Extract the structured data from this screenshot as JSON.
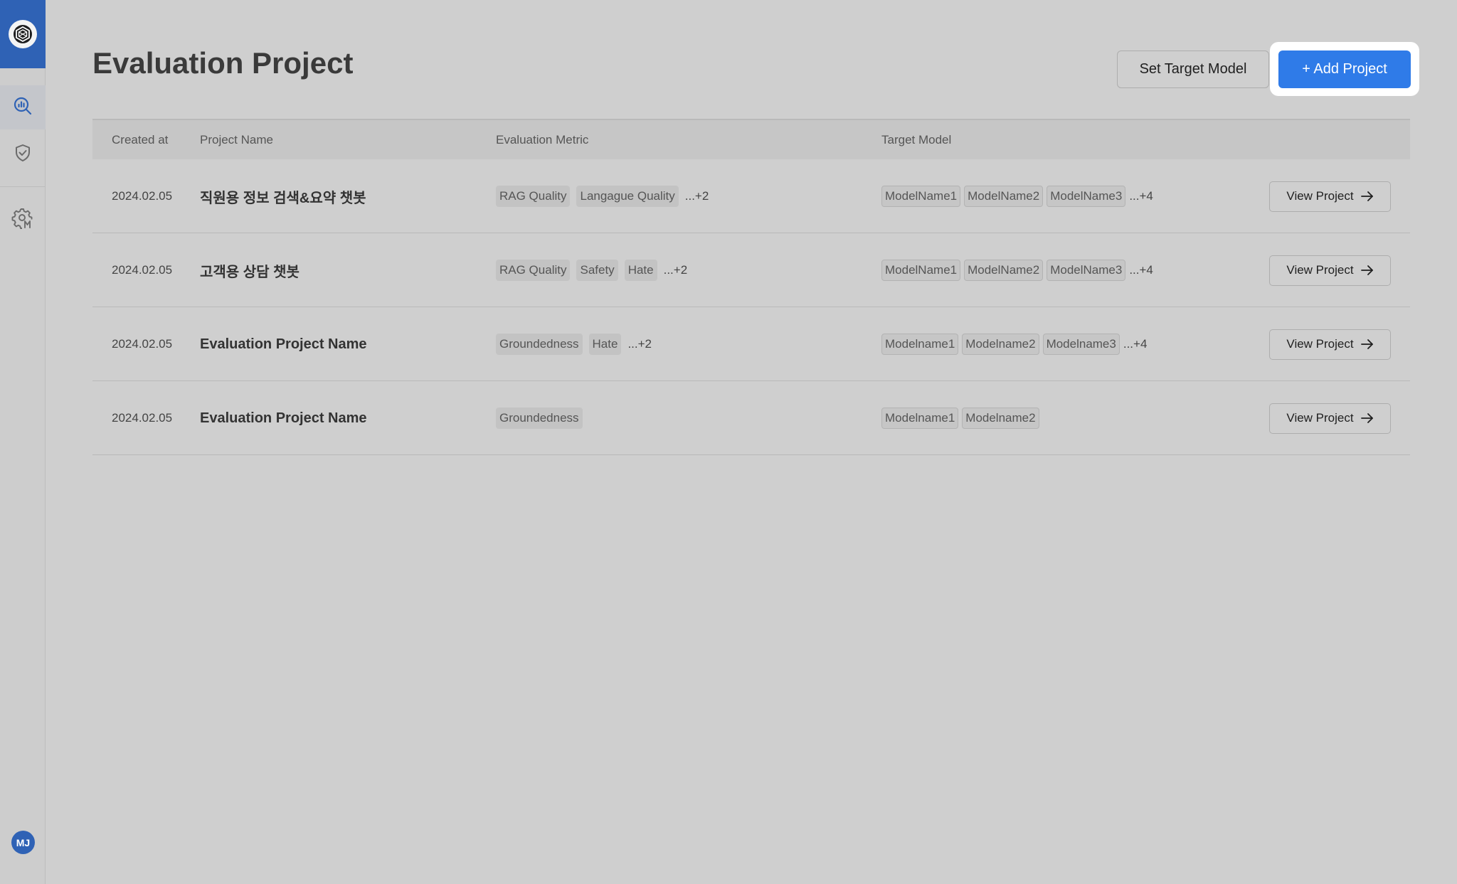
{
  "sidebar": {
    "avatar_initials": "MJ",
    "items": [
      {
        "icon": "analytics-search-icon"
      },
      {
        "icon": "shield-check-icon"
      },
      {
        "icon": "gear-model-icon"
      }
    ]
  },
  "header": {
    "title": "Evaluation Project",
    "set_target_label": "Set Target Model",
    "add_project_label": "+ Add Project"
  },
  "table": {
    "columns": {
      "created_at": "Created at",
      "project_name": "Project Name",
      "evaluation_metric": "Evaluation Metric",
      "target_model": "Target Model"
    },
    "view_label": "View Project",
    "rows": [
      {
        "date": "2024.02.05",
        "name": "직원용 정보 검색&요약 챗봇",
        "metrics": [
          "RAG Quality",
          "Langague Quality"
        ],
        "metrics_more": "...+2",
        "models": [
          "ModelName1",
          "ModelName2",
          "ModelName3"
        ],
        "models_more": "...+4"
      },
      {
        "date": "2024.02.05",
        "name": "고객용 상담 챗봇",
        "metrics": [
          "RAG Quality",
          "Safety",
          "Hate"
        ],
        "metrics_more": "...+2",
        "models": [
          "ModelName1",
          "ModelName2",
          "ModelName3"
        ],
        "models_more": "...+4"
      },
      {
        "date": "2024.02.05",
        "name": "Evaluation Project Name",
        "metrics": [
          "Groundedness",
          "Hate"
        ],
        "metrics_more": "...+2",
        "models": [
          "Modelname1",
          "Modelname2",
          "Modelname3"
        ],
        "models_more": "...+4"
      },
      {
        "date": "2024.02.05",
        "name": "Evaluation Project Name",
        "metrics": [
          "Groundedness"
        ],
        "metrics_more": "",
        "models": [
          "Modelname1",
          "Modelname2"
        ],
        "models_more": ""
      }
    ]
  },
  "colors": {
    "brand": "#2f62b5",
    "primary_button": "#2f7be8",
    "background": "#cfcfcf"
  }
}
